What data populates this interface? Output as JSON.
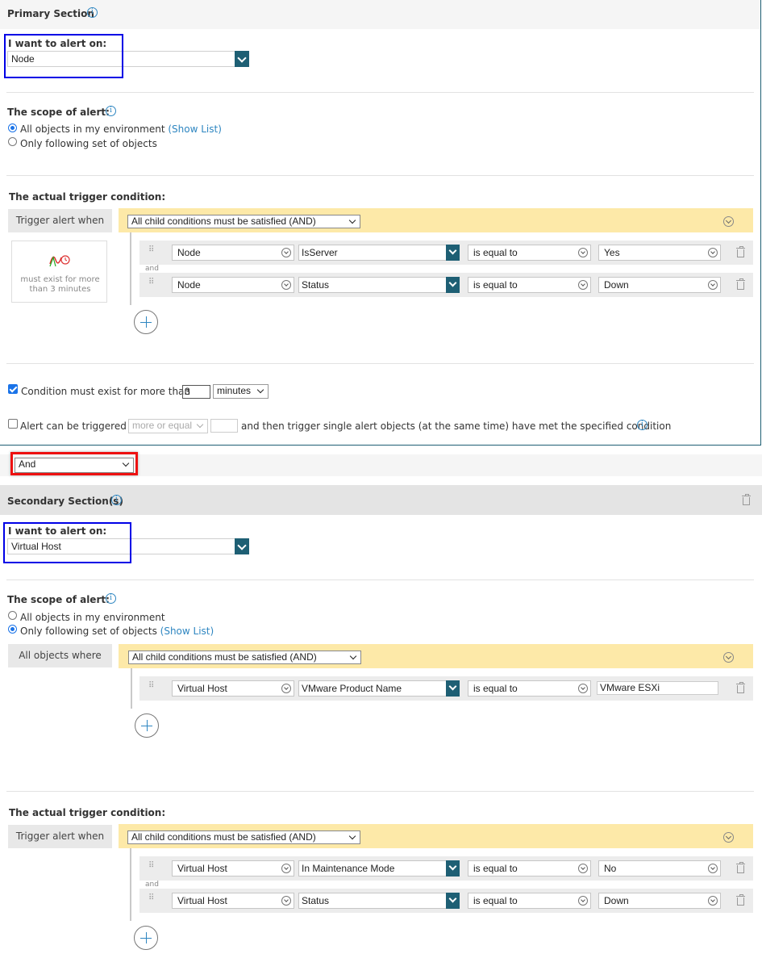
{
  "primary": {
    "title": "Primary Section",
    "alert_on_label": "I want to alert on:",
    "alert_on_value": "Node",
    "scope_label": "The scope of alert:",
    "scope_options": [
      "All objects in my environment",
      "Only following set of objects"
    ],
    "show_list": "(Show List)",
    "trigger_label": "The actual trigger condition:",
    "trigger_when": "Trigger alert when",
    "group_select": "All child conditions must be satisfied (AND)",
    "duration_note": "must exist for more than 3 minutes",
    "and_small": "and",
    "conditions": [
      {
        "entity": "Node",
        "field": "IsServer",
        "op": "is equal to",
        "value": "Yes"
      },
      {
        "entity": "Node",
        "field": "Status",
        "op": "is equal to",
        "value": "Down"
      }
    ],
    "cond_exist_label": "Condition must exist for more than",
    "cond_exist_value": "3",
    "cond_exist_unit": "minutes",
    "alert_trig_prefix": "Alert can be triggered if",
    "alert_trig_select": "more or equal",
    "alert_trig_suffix": "and then trigger single alert objects (at the same time) have met the specified condition"
  },
  "joiner": {
    "value": "And"
  },
  "secondary": {
    "title": "Secondary Section(s)",
    "alert_on_label": "I want to alert on:",
    "alert_on_value": "Virtual Host",
    "scope_label": "The scope of alert:",
    "scope_options": [
      "All objects in my environment",
      "Only following set of objects"
    ],
    "show_list": "(Show List)",
    "all_objects_where": "All objects where",
    "scope_group_select": "All child conditions must be satisfied (AND)",
    "scope_conditions": [
      {
        "entity": "Virtual Host",
        "field": "VMware Product Name",
        "op": "is equal to",
        "value": "VMware ESXi"
      }
    ],
    "trigger_label": "The actual trigger condition:",
    "trigger_when": "Trigger alert when",
    "group_select": "All child conditions must be satisfied (AND)",
    "and_small": "and",
    "conditions": [
      {
        "entity": "Virtual Host",
        "field": "In Maintenance Mode",
        "op": "is equal to",
        "value": "No"
      },
      {
        "entity": "Virtual Host",
        "field": "Status",
        "op": "is equal to",
        "value": "Down"
      }
    ]
  },
  "icons": [
    "info-icon",
    "trash-icon",
    "add-icon",
    "drag-handle-icon",
    "chevron-down-icon",
    "duration-chart-icon"
  ],
  "colors": {
    "accent": "#1e5f74",
    "link": "#2e86c1",
    "group_bg": "#fde9a8",
    "highlight_blue": "#0000e6",
    "highlight_red": "#ee1111"
  }
}
